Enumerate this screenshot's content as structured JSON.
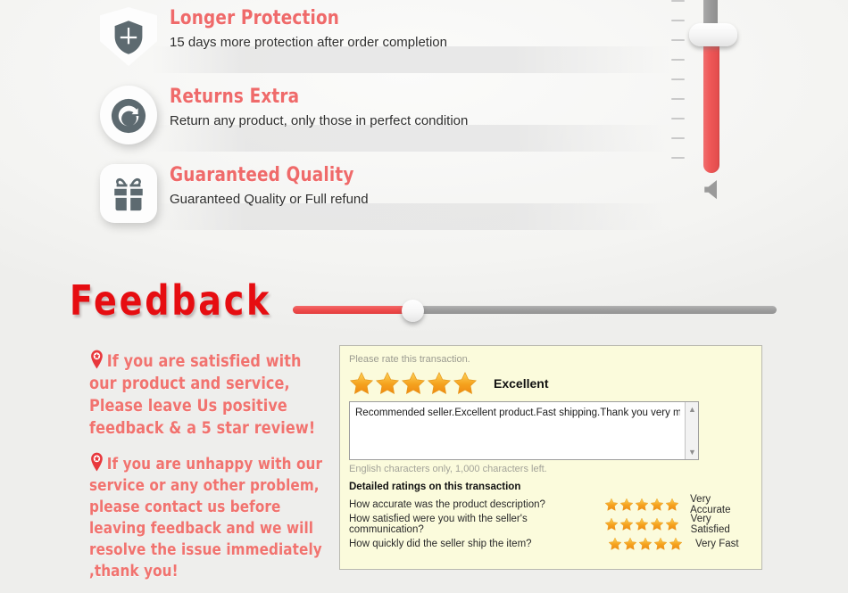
{
  "features": [
    {
      "icon": "shield-plus-icon",
      "title": "Longer Protection",
      "subtitle": "15 days more protection after order completion"
    },
    {
      "icon": "return-arrow-circle-icon",
      "title": "Returns Extra",
      "subtitle": "Return any product, only those in perfect condition"
    },
    {
      "icon": "gift-box-icon",
      "title": "Guaranteed Quality",
      "subtitle": "Guaranteed Quality or Full refund"
    }
  ],
  "volume_slider": {
    "name": "vertical-volume-slider",
    "orientation": "vertical",
    "value_percent": 77,
    "tick_count": 9,
    "speaker_icon": "speaker-icon",
    "fill_color": "#ee5353",
    "track_color": "#9b9b9b"
  },
  "progress_slider": {
    "name": "horizontal-slider",
    "orientation": "horizontal",
    "value_percent": 25,
    "fill_color": "#ee4a4a",
    "track_color": "#9d9d9d"
  },
  "feedback_section": {
    "heading": "Feedback",
    "paragraphs": [
      {
        "icon": "map-pin-star-icon",
        "text": "If you are satisfied with our product and service, Please leave Us positive feedback & a 5 star review!"
      },
      {
        "icon": "map-pin-star-icon",
        "text": "If you are unhappy with our service or any other problem, please contact us before leaving feedback and we will resolve the issue immediately ,thank you!"
      }
    ],
    "heading_color": "#e60d11",
    "paragraph_color": "#f1736f"
  },
  "rating_panel": {
    "prompt": "Please rate this transaction.",
    "overall_stars": 5,
    "overall_label": "Excellent",
    "comment_value": "Recommended seller.Excellent product.Fast shipping.Thank you very much.",
    "comment_note": "English characters only, 1,000 characters left.",
    "scroll_up_glyph": "▲",
    "scroll_down_glyph": "▼",
    "detailed_title": "Detailed ratings on this transaction",
    "detailed_rows": [
      {
        "question": "How accurate was the product description?",
        "stars": 5,
        "label": "Very Accurate"
      },
      {
        "question": "How satisfied were you with the seller's communication?",
        "stars": 5,
        "label": "Very Satisfied"
      },
      {
        "question": "How quickly did the seller ship the item?",
        "stars": 5,
        "label": "Very Fast"
      }
    ],
    "panel_bg": "#fbfbdc",
    "star_color": "#f5a21e"
  }
}
